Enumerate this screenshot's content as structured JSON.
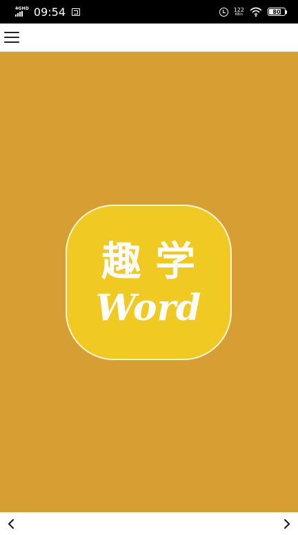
{
  "status_bar": {
    "network": "4GHD",
    "time": "09:54",
    "net_speed_value": "122",
    "net_speed_unit": "KB/s",
    "battery": "80",
    "battery_level": 0.8,
    "icons": [
      "signal-icon",
      "message-icon",
      "alarm-icon",
      "wifi-icon",
      "battery-icon"
    ]
  },
  "app_bar": {
    "menu_icon": "hamburger-menu-icon"
  },
  "logo": {
    "chinese": "趣 学",
    "english": "Word",
    "colors": {
      "background": "#d79e33",
      "badge": "#f0ca22",
      "border": "#fff6d8",
      "text": "#ffffff"
    }
  },
  "bottom_nav": {
    "back_icon": "chevron-left-icon",
    "forward_icon": "chevron-right-icon"
  }
}
